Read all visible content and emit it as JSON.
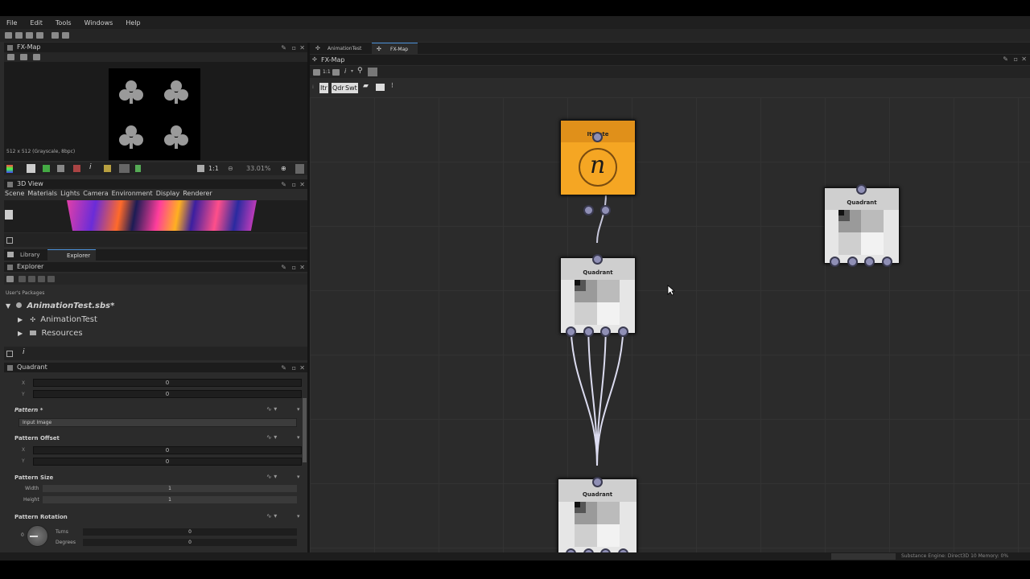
{
  "menu": [
    "File",
    "Edit",
    "Tools",
    "Windows",
    "Help"
  ],
  "fxmap_preview": {
    "title": "FX-Map",
    "resolution": "512 x 512 (Grayscale, 8bpc)",
    "scale": "1:1",
    "zoom": "33.01%"
  },
  "view3d": {
    "title": "3D View",
    "menu": [
      "Scene",
      "Materials",
      "Lights",
      "Camera",
      "Environment",
      "Display",
      "Renderer"
    ]
  },
  "explorer": {
    "tabs": [
      "Library",
      "Explorer"
    ],
    "title": "Explorer",
    "section": "User's Packages",
    "package": "AnimationTest.sbs*",
    "items": [
      "AnimationTest",
      "Resources"
    ]
  },
  "properties": {
    "title": "Quadrant",
    "x_label": "X",
    "y_label": "Y",
    "top_x": "0",
    "top_y": "0",
    "pattern_label": "Pattern *",
    "pattern_value": "Input Image",
    "offset_label": "Pattern Offset",
    "offset_x": "0",
    "offset_y": "0",
    "size_label": "Pattern Size",
    "width_label": "Width",
    "width_value": "1",
    "height_label": "Height",
    "height_value": "1",
    "rotation_label": "Pattern Rotation",
    "turns_label": "Turns",
    "turns_value": "0",
    "degrees_label": "Degrees",
    "degrees_value": "0",
    "dial_zero": "0"
  },
  "graph": {
    "tabs": [
      "AnimationTest",
      "FX-Map"
    ],
    "title": "FX-Map",
    "scale_label": "1:1",
    "quad_tools": [
      "Itr",
      "Qdr",
      "Swt"
    ],
    "nodes": {
      "iterate": {
        "title": "Iterate",
        "glyph": "n"
      },
      "quadrant1": {
        "title": "Quadrant"
      },
      "quadrant2": {
        "title": "Quadrant"
      },
      "quadrant3": {
        "title": "Quadrant"
      }
    }
  },
  "statusbar": "Substance Engine: Direct3D 10  Memory: 0%",
  "colors": {
    "iterate_orange": "#f5a623",
    "port": "#8f8fb5",
    "wire": "#dcdcf0",
    "canvas": "#2b2b2b"
  }
}
